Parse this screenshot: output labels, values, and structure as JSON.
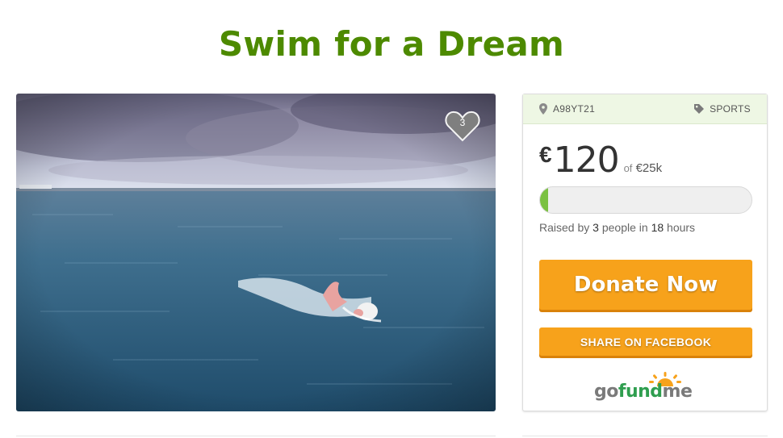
{
  "campaign": {
    "title": "Swim for a Dream",
    "heart_count": "3"
  },
  "details": {
    "location": "A98YT21",
    "category": "SPORTS",
    "currency": "€",
    "raised_amount": "120",
    "goal_prefix": "of",
    "goal": "€25k",
    "progress_fraction": 0.005,
    "raised_by_prefix": "Raised by",
    "donor_count": "3",
    "raised_by_mid": "people in",
    "duration_value": "18",
    "duration_unit": "hours"
  },
  "actions": {
    "donate_label": "Donate Now",
    "share_label": "SHARE ON FACEBOOK"
  },
  "branding": {
    "logo_go": "go",
    "logo_fund": "fund",
    "logo_me": "me"
  },
  "colors": {
    "title_green": "#4d8a00",
    "button_orange": "#f7a21b",
    "progress_green": "#7bc142",
    "header_tint": "#eef7e4"
  },
  "icons": [
    "location-pin-icon",
    "tag-icon",
    "heart-icon",
    "sun-rays-icon"
  ]
}
